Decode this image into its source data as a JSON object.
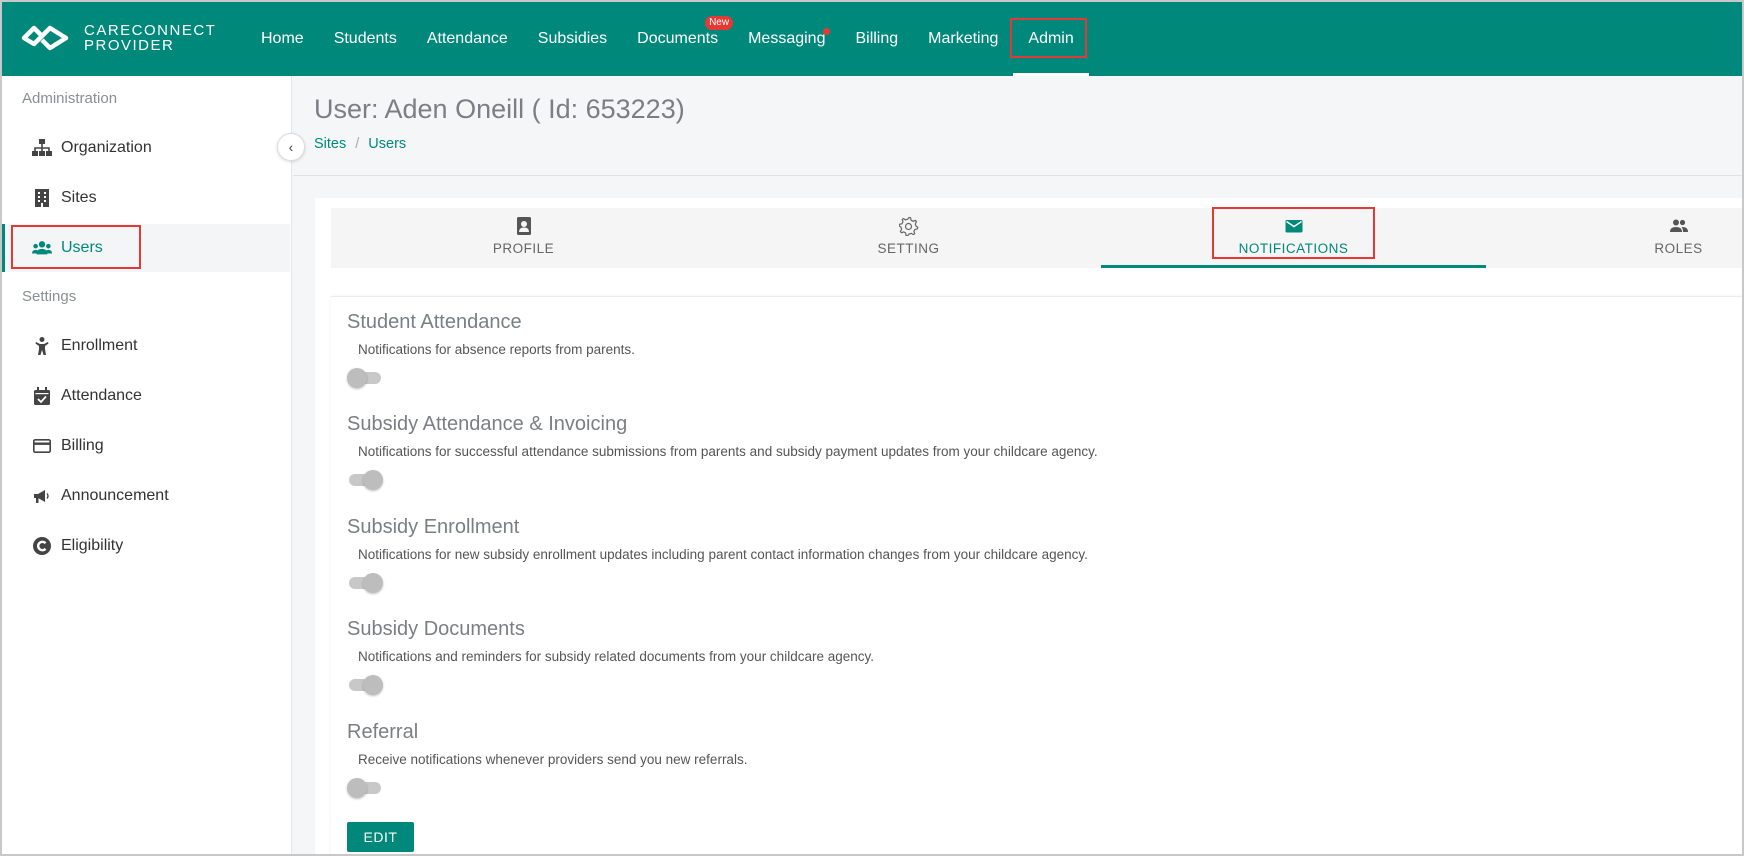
{
  "brand": {
    "line1": "CARECONNECT",
    "line2": "PROVIDER"
  },
  "nav": {
    "items": [
      {
        "label": "Home"
      },
      {
        "label": "Students"
      },
      {
        "label": "Attendance"
      },
      {
        "label": "Subsidies"
      },
      {
        "label": "Documents",
        "badge": "New"
      },
      {
        "label": "Messaging"
      },
      {
        "label": "Billing"
      },
      {
        "label": "Marketing"
      },
      {
        "label": "Admin"
      }
    ],
    "active": "Admin"
  },
  "sidebar": {
    "sections": [
      {
        "heading": "Administration",
        "items": [
          {
            "label": "Organization",
            "icon": "sitemap-icon"
          },
          {
            "label": "Sites",
            "icon": "building-icon"
          },
          {
            "label": "Users",
            "icon": "users-icon"
          }
        ]
      },
      {
        "heading": "Settings",
        "items": [
          {
            "label": "Enrollment",
            "icon": "child-icon"
          },
          {
            "label": "Attendance",
            "icon": "calendar-check-icon"
          },
          {
            "label": "Billing",
            "icon": "credit-card-icon"
          },
          {
            "label": "Announcement",
            "icon": "megaphone-icon"
          },
          {
            "label": "Eligibility",
            "icon": "eligibility-icon"
          }
        ]
      }
    ],
    "active": "Users",
    "collapse_glyph": "‹"
  },
  "header": {
    "title": "User: Aden Oneill ( Id: 653223)",
    "breadcrumb": [
      "Sites",
      "Users"
    ],
    "breadcrumb_sep": "/"
  },
  "tabs": {
    "items": [
      {
        "label": "PROFILE",
        "icon": "contact-card-icon"
      },
      {
        "label": "SETTING",
        "icon": "gear-icon"
      },
      {
        "label": "NOTIFICATIONS",
        "icon": "envelope-icon"
      },
      {
        "label": "ROLES",
        "icon": "people-icon"
      }
    ],
    "active": "NOTIFICATIONS"
  },
  "notifications": [
    {
      "title": "Student Attendance",
      "description": "Notifications for absence reports from parents.",
      "enabled": false
    },
    {
      "title": "Subsidy Attendance & Invoicing",
      "description": "Notifications for successful attendance submissions from parents and subsidy payment updates from your childcare agency.",
      "enabled": true
    },
    {
      "title": "Subsidy Enrollment",
      "description": "Notifications for new subsidy enrollment updates including parent contact information changes from your childcare agency.",
      "enabled": true
    },
    {
      "title": "Subsidy Documents",
      "description": "Notifications and reminders for subsidy related documents from your childcare agency.",
      "enabled": true
    },
    {
      "title": "Referral",
      "description": "Receive notifications whenever providers send you new referrals.",
      "enabled": false
    }
  ],
  "edit_label": "EDIT",
  "colors": {
    "primary": "#00897b",
    "highlight": "#e53935",
    "muted_title": "#7b7f83"
  }
}
